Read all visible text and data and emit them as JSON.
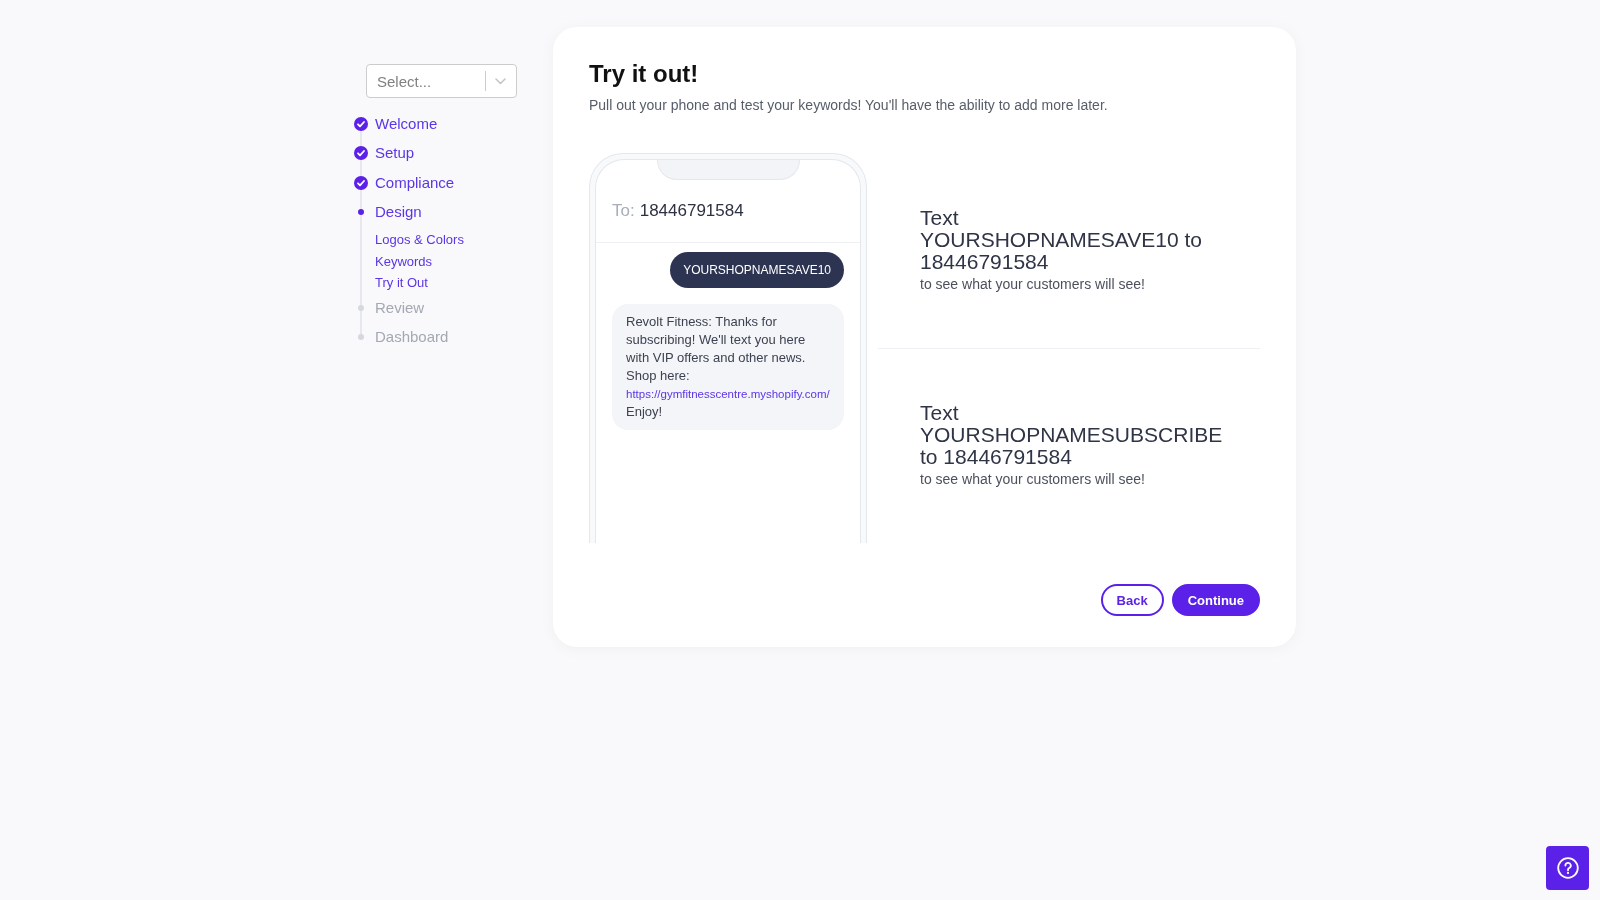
{
  "sidebar": {
    "select": {
      "placeholder": "Select..."
    },
    "steps": [
      {
        "label": "Welcome",
        "kind": "completed"
      },
      {
        "label": "Setup",
        "kind": "completed"
      },
      {
        "label": "Compliance",
        "kind": "completed"
      },
      {
        "label": "Design",
        "kind": "current",
        "children": [
          {
            "label": "Logos & Colors"
          },
          {
            "label": "Keywords"
          },
          {
            "label": "Try it Out"
          }
        ]
      },
      {
        "label": "Review",
        "kind": "upcoming"
      },
      {
        "label": "Dashboard",
        "kind": "upcoming"
      }
    ]
  },
  "main": {
    "title": "Try it out!",
    "subtitle": "Pull out your phone and test your keywords! You'll have the ability to add more later.",
    "phone": {
      "recipient_label": "To:",
      "recipient_number": "18446791584",
      "messages": [
        {
          "kind": "sent",
          "text": "YOURSHOPNAMESAVE10"
        },
        {
          "kind": "received",
          "text": "Revolt Fitness: Thanks for subscribing! We'll text you here with VIP offers and other news. Shop here:",
          "link": "https://gymfitnesscentre.myshopify.com/",
          "text_after": "Enjoy!"
        }
      ]
    },
    "keywords": [
      {
        "lead": "Text",
        "message": "YOURSHOPNAMESAVE10 to 18446791584",
        "note": "to see what your customers will see!"
      },
      {
        "lead": "Text",
        "message": "YOURSHOPNAMESUBSCRIBE to 18446791584",
        "note": "to see what your customers will see!"
      }
    ],
    "buttons": [
      {
        "label": "Back",
        "kind": "secondary"
      },
      {
        "label": "Continue",
        "kind": "primary"
      }
    ]
  }
}
